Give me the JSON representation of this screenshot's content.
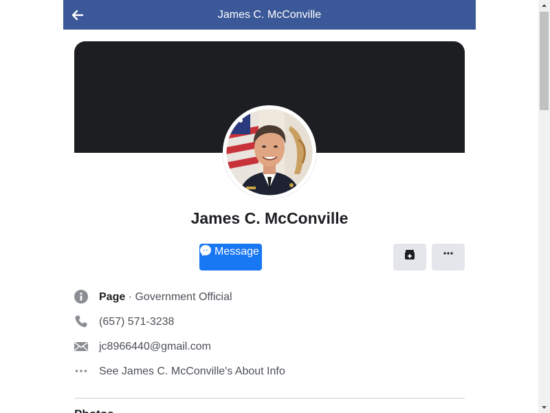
{
  "header": {
    "title": "James C. McConville",
    "back_icon": "back-arrow-icon"
  },
  "profile": {
    "name": "James C. McConville",
    "cover_color": "#1c1e21",
    "avatar_icon": "profile-photo"
  },
  "actions": {
    "message_label": "Message",
    "message_icon": "messenger-icon",
    "save_icon": "save-icon",
    "more_icon": "more-horizontal-icon"
  },
  "info": {
    "category_label": "Page",
    "category_separator": " · ",
    "category_value": "Government Official",
    "phone": "(657) 571-3238",
    "email": "jc8966440@gmail.com",
    "about_link": "See James C. McConville's About Info"
  },
  "next_section": {
    "heading": "Photos"
  },
  "colors": {
    "header_bg": "#3b5998",
    "primary_button": "#1877f2",
    "secondary_button": "#e4e6eb",
    "text_secondary": "#4b4f56"
  }
}
